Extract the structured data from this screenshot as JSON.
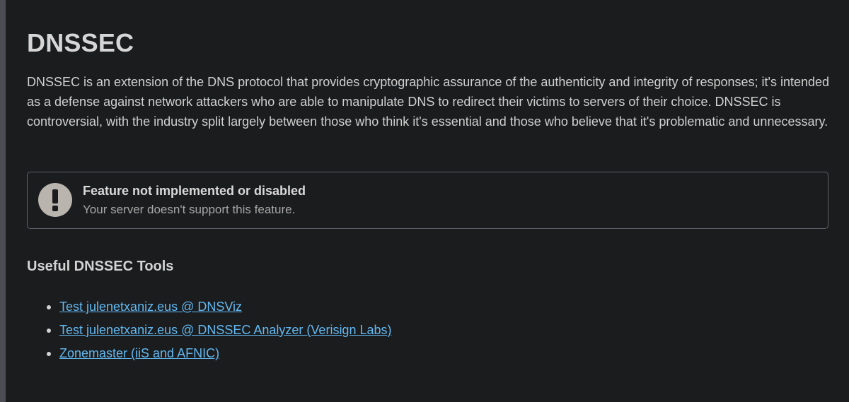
{
  "page": {
    "title": "DNSSEC",
    "description": "DNSSEC is an extension of the DNS protocol that provides cryptographic assurance of the authenticity and integrity of responses; it's intended as a defense against network attackers who are able to manipulate DNS to redirect their victims to servers of their choice. DNSSEC is controversial, with the industry split largely between those who think it's essential and those who believe that it's problematic and unnecessary."
  },
  "alert": {
    "icon": "exclamation-circle-icon",
    "title": "Feature not implemented or disabled",
    "text": "Your server doesn't support this feature."
  },
  "tools": {
    "heading": "Useful DNSSEC Tools",
    "links": [
      {
        "label": "Test julenetxaniz.eus @ DNSViz"
      },
      {
        "label": "Test julenetxaniz.eus @ DNSSEC Analyzer (Verisign Labs)"
      },
      {
        "label": "Zonemaster (iiS and AFNIC)"
      }
    ]
  },
  "colors": {
    "background": "#1b1c1e",
    "link": "#62b8f0",
    "alert_border": "#5e6166",
    "icon": "#b9b4ad"
  }
}
